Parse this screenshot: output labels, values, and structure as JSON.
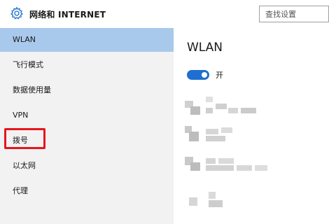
{
  "header": {
    "title": "网络和 INTERNET",
    "search_placeholder": "查找设置",
    "icon": "gear-icon"
  },
  "sidebar": {
    "items": [
      {
        "label": "WLAN",
        "selected": true
      },
      {
        "label": "飞行模式"
      },
      {
        "label": "数据使用量"
      },
      {
        "label": "VPN"
      },
      {
        "label": "拨号",
        "annotated": true
      },
      {
        "label": "以太网"
      },
      {
        "label": "代理"
      }
    ]
  },
  "main": {
    "title": "WLAN",
    "toggle_label": "开",
    "toggle_on": true
  },
  "colors": {
    "selected_bg": "#a9c9ec",
    "accent": "#1e6fd0",
    "annotation": "#e5161d",
    "sidebar_bg": "#f2f2f2"
  }
}
